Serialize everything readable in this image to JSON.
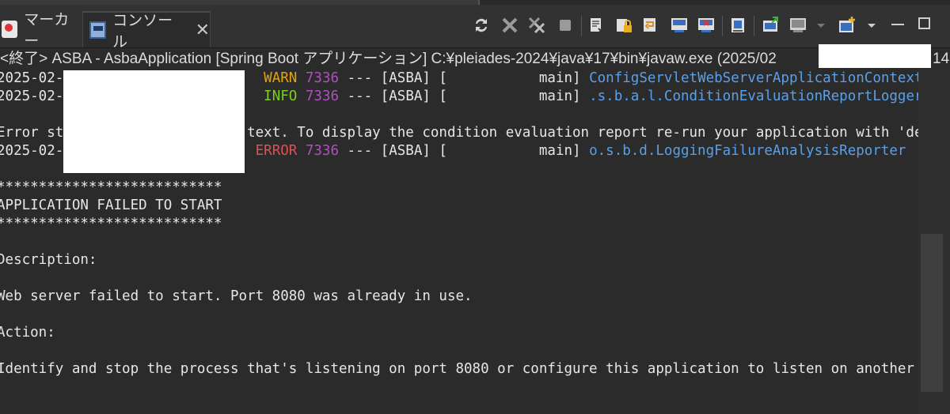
{
  "tabs": {
    "markers_label": "マーカー",
    "console_label": "コンソール",
    "close_glyph": "✕"
  },
  "process_header": "<終了> ASBA - AsbaApplication [Spring Boot アプリケーション] C:¥pleiades-2024¥java¥17¥bin¥javaw.exe  (2025/02",
  "process_header_tail": "14",
  "log": [
    {
      "ts": "2025-02-",
      "level": "WARN",
      "pid": "7336",
      "mid": " --- [ASBA] [           main] ",
      "cls": "ConfigServletWebServerApplicationContext"
    },
    {
      "ts": "2025-02-",
      "level": "INFO",
      "pid": "7336",
      "mid": " --- [ASBA] [           main] ",
      "cls": ".s.b.a.l.ConditionEvaluationReportLogger"
    },
    {
      "ts": "2025-02-",
      "level": "ERROR",
      "pid": "7336",
      "mid": " --- [ASBA] [           main] ",
      "cls": "o.s.b.d.LoggingFailureAnalysisReporter"
    }
  ],
  "error_start_a": "Error st",
  "error_start_b": "text. To display the condition evaluation report re-run your application with 'deb",
  "stars": "***************************",
  "failed": "APPLICATION FAILED TO START",
  "description_label": "Description:",
  "description_text": "Web server failed to start. Port 8080 was already in use.",
  "action_label": "Action:",
  "action_text": "Identify and stop the process that's listening on port 8080 or configure this application to listen on another",
  "colors": {
    "warn": "#e5a50a",
    "info": "#7ad11d",
    "error": "#e05050",
    "pid": "#b04ec0",
    "class": "#5aa0e8"
  }
}
